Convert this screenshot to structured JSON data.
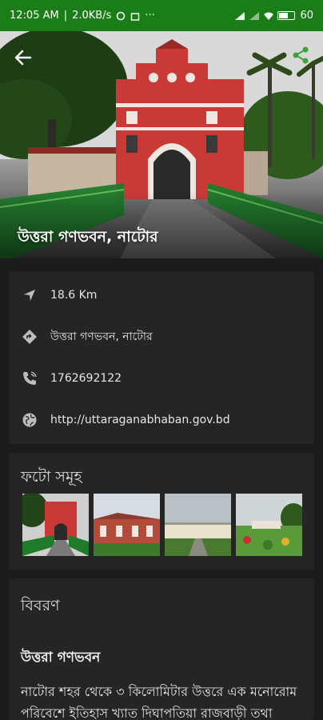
{
  "status_bar": {
    "time": "12:05 AM",
    "speed": "2.0KB/s",
    "battery": "60"
  },
  "header": {
    "title": "উত্তরা গণভবন, নাটোর"
  },
  "info": {
    "distance": "18.6 Km",
    "address": "উত্তরা গণভবন, নাটোর",
    "phone": "1762692122",
    "website": "http://uttaraganabhaban.gov.bd"
  },
  "photos": {
    "title": "ফটো সমূহ"
  },
  "description": {
    "section_title": "বিবরণ",
    "heading": "উত্তরা গণভবন",
    "text": "নাটোর শহর থেকে ৩ কিলোমিটার উত্তরে এক মনোরোম পরিবেশে ইতিহাস খ্যাত দিঘাপতিয়া রাজবাড়ী তথা"
  },
  "colors": {
    "status_bar": "#1a7d17",
    "background": "#1b1b1b",
    "card": "#252525",
    "accent_green": "#3ea43a"
  }
}
